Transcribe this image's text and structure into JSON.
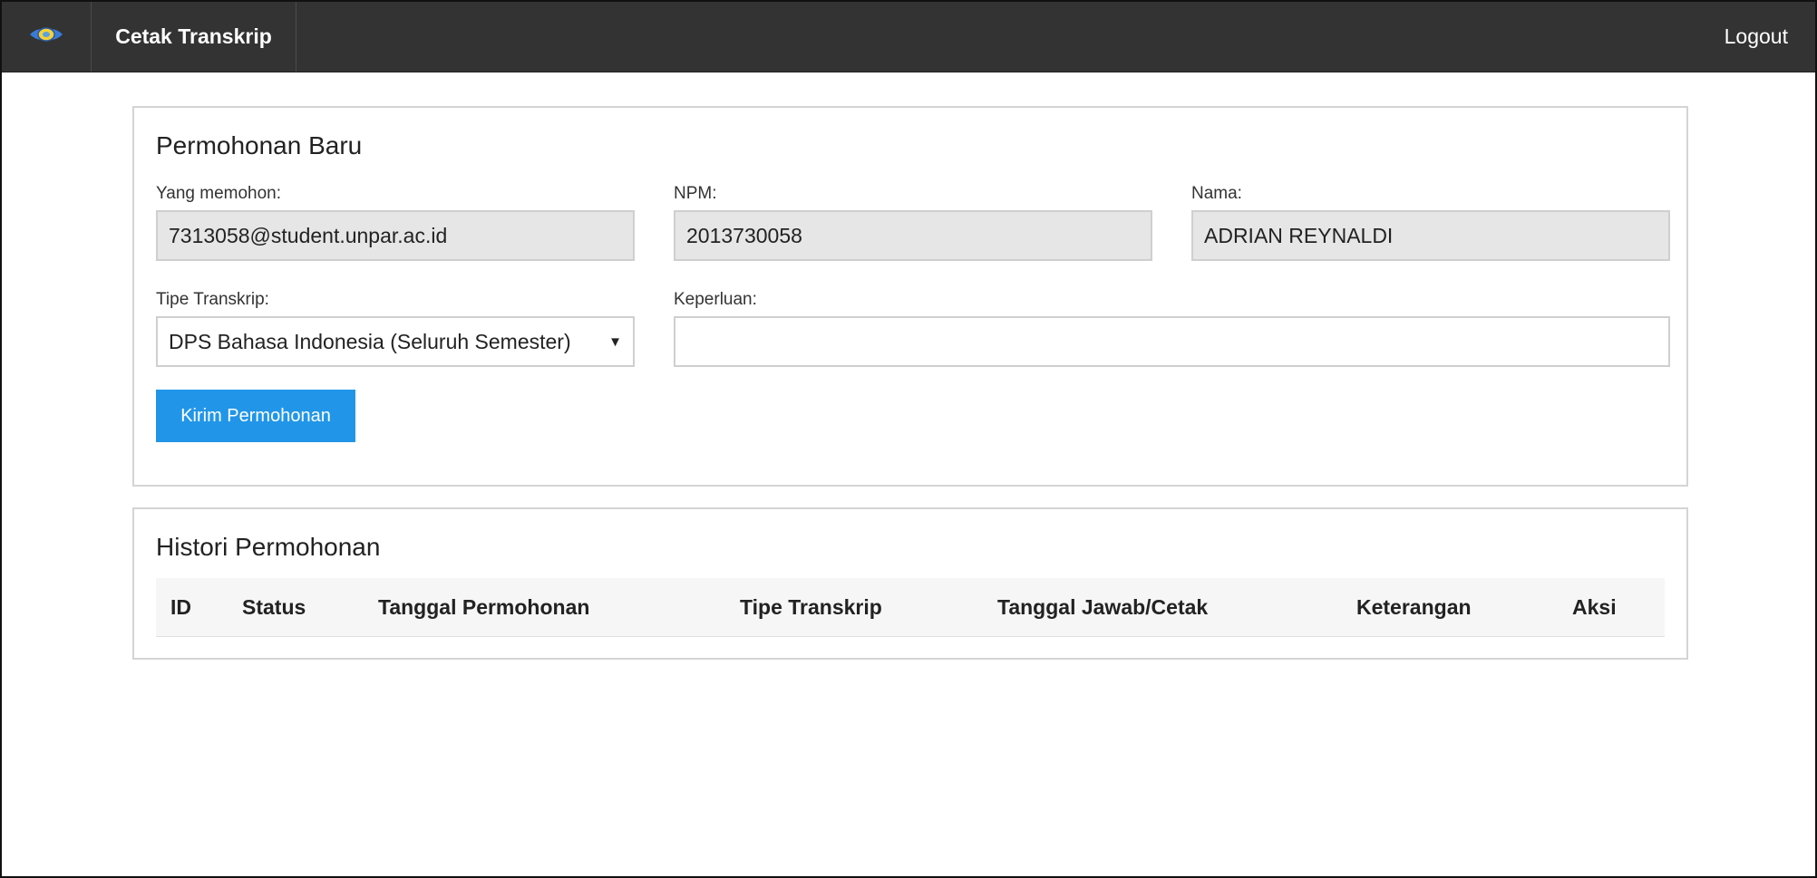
{
  "navbar": {
    "logo_icon": "university-logo-icon",
    "brand": "Cetak Transkrip",
    "logout": "Logout"
  },
  "new_request": {
    "title": "Permohonan Baru",
    "requester_label": "Yang memohon:",
    "requester_value": "7313058@student.unpar.ac.id",
    "npm_label": "NPM:",
    "npm_value": "2013730058",
    "name_label": "Nama:",
    "name_value": "ADRIAN REYNALDI",
    "type_label": "Tipe Transkrip:",
    "type_value": "DPS Bahasa Indonesia (Seluruh Semester)",
    "purpose_label": "Keperluan:",
    "purpose_value": "",
    "submit_label": "Kirim Permohonan"
  },
  "history": {
    "title": "Histori Permohonan",
    "columns": [
      "ID",
      "Status",
      "Tanggal Permohonan",
      "Tipe Transkrip",
      "Tanggal Jawab/Cetak",
      "Keterangan",
      "Aksi"
    ]
  },
  "colors": {
    "navbar_bg": "#333333",
    "primary_button": "#2196e8",
    "readonly_bg": "#e6e6e6"
  }
}
